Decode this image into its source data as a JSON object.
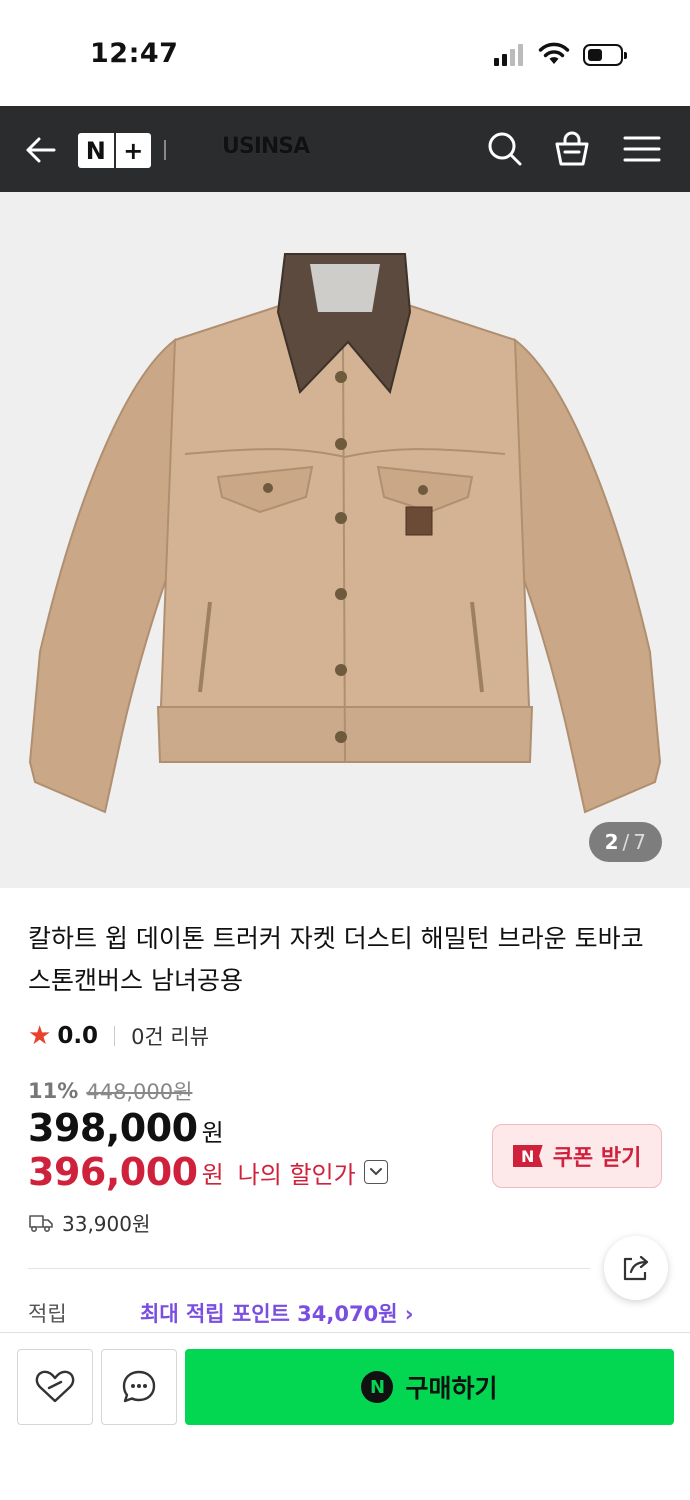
{
  "status_bar": {
    "time": "12:47"
  },
  "nav": {
    "np_left": "N",
    "np_right": "+",
    "brand": "USINSA"
  },
  "gallery": {
    "current": "2",
    "separator": "/",
    "total": "7"
  },
  "product": {
    "title": "칼하트 윕 데이톤 트러커 자켓 더스티 해밀턴 브라운 토바코 스톤캔버스 남녀공용",
    "rating_score": "0.0",
    "review_count": "0건 리뷰",
    "discount_pct": "11%",
    "original_price": "448,000원",
    "price": "398,000",
    "price_unit": "원",
    "my_price": "396,000",
    "my_price_unit": "원",
    "my_price_label": "나의 할인가",
    "shipping_fee": "33,900원",
    "points_label": "적립",
    "points_value": "최대 적립 포인트 34,070원 ›"
  },
  "coupon": {
    "badge": "N",
    "label": "쿠폰 받기"
  },
  "bottom_bar": {
    "buy_logo": "N",
    "buy_label": "구매하기"
  },
  "colors": {
    "nav_bg": "#2b2c2e",
    "sale_red": "#d0213c",
    "buy_green": "#03d752",
    "points_purple": "#7a4ee0",
    "star": "#e8412c"
  }
}
